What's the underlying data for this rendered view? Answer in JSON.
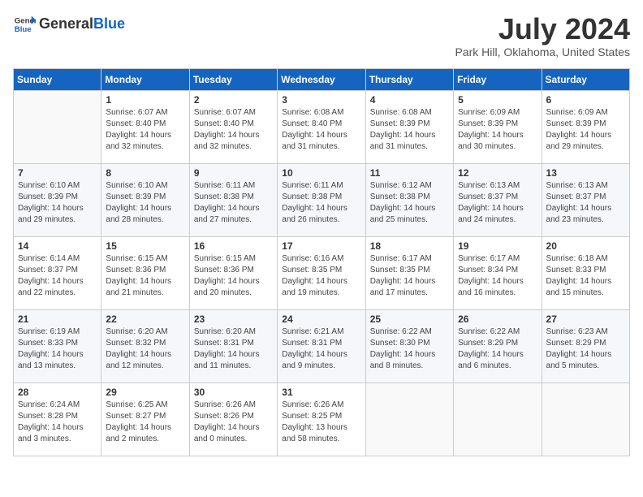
{
  "logo": {
    "general": "General",
    "blue": "Blue"
  },
  "title": "July 2024",
  "subtitle": "Park Hill, Oklahoma, United States",
  "weekdays": [
    "Sunday",
    "Monday",
    "Tuesday",
    "Wednesday",
    "Thursday",
    "Friday",
    "Saturday"
  ],
  "weeks": [
    [
      {
        "day": "",
        "info": ""
      },
      {
        "day": "1",
        "info": "Sunrise: 6:07 AM\nSunset: 8:40 PM\nDaylight: 14 hours\nand 32 minutes."
      },
      {
        "day": "2",
        "info": "Sunrise: 6:07 AM\nSunset: 8:40 PM\nDaylight: 14 hours\nand 32 minutes."
      },
      {
        "day": "3",
        "info": "Sunrise: 6:08 AM\nSunset: 8:40 PM\nDaylight: 14 hours\nand 31 minutes."
      },
      {
        "day": "4",
        "info": "Sunrise: 6:08 AM\nSunset: 8:39 PM\nDaylight: 14 hours\nand 31 minutes."
      },
      {
        "day": "5",
        "info": "Sunrise: 6:09 AM\nSunset: 8:39 PM\nDaylight: 14 hours\nand 30 minutes."
      },
      {
        "day": "6",
        "info": "Sunrise: 6:09 AM\nSunset: 8:39 PM\nDaylight: 14 hours\nand 29 minutes."
      }
    ],
    [
      {
        "day": "7",
        "info": "Sunrise: 6:10 AM\nSunset: 8:39 PM\nDaylight: 14 hours\nand 29 minutes."
      },
      {
        "day": "8",
        "info": "Sunrise: 6:10 AM\nSunset: 8:39 PM\nDaylight: 14 hours\nand 28 minutes."
      },
      {
        "day": "9",
        "info": "Sunrise: 6:11 AM\nSunset: 8:38 PM\nDaylight: 14 hours\nand 27 minutes."
      },
      {
        "day": "10",
        "info": "Sunrise: 6:11 AM\nSunset: 8:38 PM\nDaylight: 14 hours\nand 26 minutes."
      },
      {
        "day": "11",
        "info": "Sunrise: 6:12 AM\nSunset: 8:38 PM\nDaylight: 14 hours\nand 25 minutes."
      },
      {
        "day": "12",
        "info": "Sunrise: 6:13 AM\nSunset: 8:37 PM\nDaylight: 14 hours\nand 24 minutes."
      },
      {
        "day": "13",
        "info": "Sunrise: 6:13 AM\nSunset: 8:37 PM\nDaylight: 14 hours\nand 23 minutes."
      }
    ],
    [
      {
        "day": "14",
        "info": "Sunrise: 6:14 AM\nSunset: 8:37 PM\nDaylight: 14 hours\nand 22 minutes."
      },
      {
        "day": "15",
        "info": "Sunrise: 6:15 AM\nSunset: 8:36 PM\nDaylight: 14 hours\nand 21 minutes."
      },
      {
        "day": "16",
        "info": "Sunrise: 6:15 AM\nSunset: 8:36 PM\nDaylight: 14 hours\nand 20 minutes."
      },
      {
        "day": "17",
        "info": "Sunrise: 6:16 AM\nSunset: 8:35 PM\nDaylight: 14 hours\nand 19 minutes."
      },
      {
        "day": "18",
        "info": "Sunrise: 6:17 AM\nSunset: 8:35 PM\nDaylight: 14 hours\nand 17 minutes."
      },
      {
        "day": "19",
        "info": "Sunrise: 6:17 AM\nSunset: 8:34 PM\nDaylight: 14 hours\nand 16 minutes."
      },
      {
        "day": "20",
        "info": "Sunrise: 6:18 AM\nSunset: 8:33 PM\nDaylight: 14 hours\nand 15 minutes."
      }
    ],
    [
      {
        "day": "21",
        "info": "Sunrise: 6:19 AM\nSunset: 8:33 PM\nDaylight: 14 hours\nand 13 minutes."
      },
      {
        "day": "22",
        "info": "Sunrise: 6:20 AM\nSunset: 8:32 PM\nDaylight: 14 hours\nand 12 minutes."
      },
      {
        "day": "23",
        "info": "Sunrise: 6:20 AM\nSunset: 8:31 PM\nDaylight: 14 hours\nand 11 minutes."
      },
      {
        "day": "24",
        "info": "Sunrise: 6:21 AM\nSunset: 8:31 PM\nDaylight: 14 hours\nand 9 minutes."
      },
      {
        "day": "25",
        "info": "Sunrise: 6:22 AM\nSunset: 8:30 PM\nDaylight: 14 hours\nand 8 minutes."
      },
      {
        "day": "26",
        "info": "Sunrise: 6:22 AM\nSunset: 8:29 PM\nDaylight: 14 hours\nand 6 minutes."
      },
      {
        "day": "27",
        "info": "Sunrise: 6:23 AM\nSunset: 8:29 PM\nDaylight: 14 hours\nand 5 minutes."
      }
    ],
    [
      {
        "day": "28",
        "info": "Sunrise: 6:24 AM\nSunset: 8:28 PM\nDaylight: 14 hours\nand 3 minutes."
      },
      {
        "day": "29",
        "info": "Sunrise: 6:25 AM\nSunset: 8:27 PM\nDaylight: 14 hours\nand 2 minutes."
      },
      {
        "day": "30",
        "info": "Sunrise: 6:26 AM\nSunset: 8:26 PM\nDaylight: 14 hours\nand 0 minutes."
      },
      {
        "day": "31",
        "info": "Sunrise: 6:26 AM\nSunset: 8:25 PM\nDaylight: 13 hours\nand 58 minutes."
      },
      {
        "day": "",
        "info": ""
      },
      {
        "day": "",
        "info": ""
      },
      {
        "day": "",
        "info": ""
      }
    ]
  ]
}
